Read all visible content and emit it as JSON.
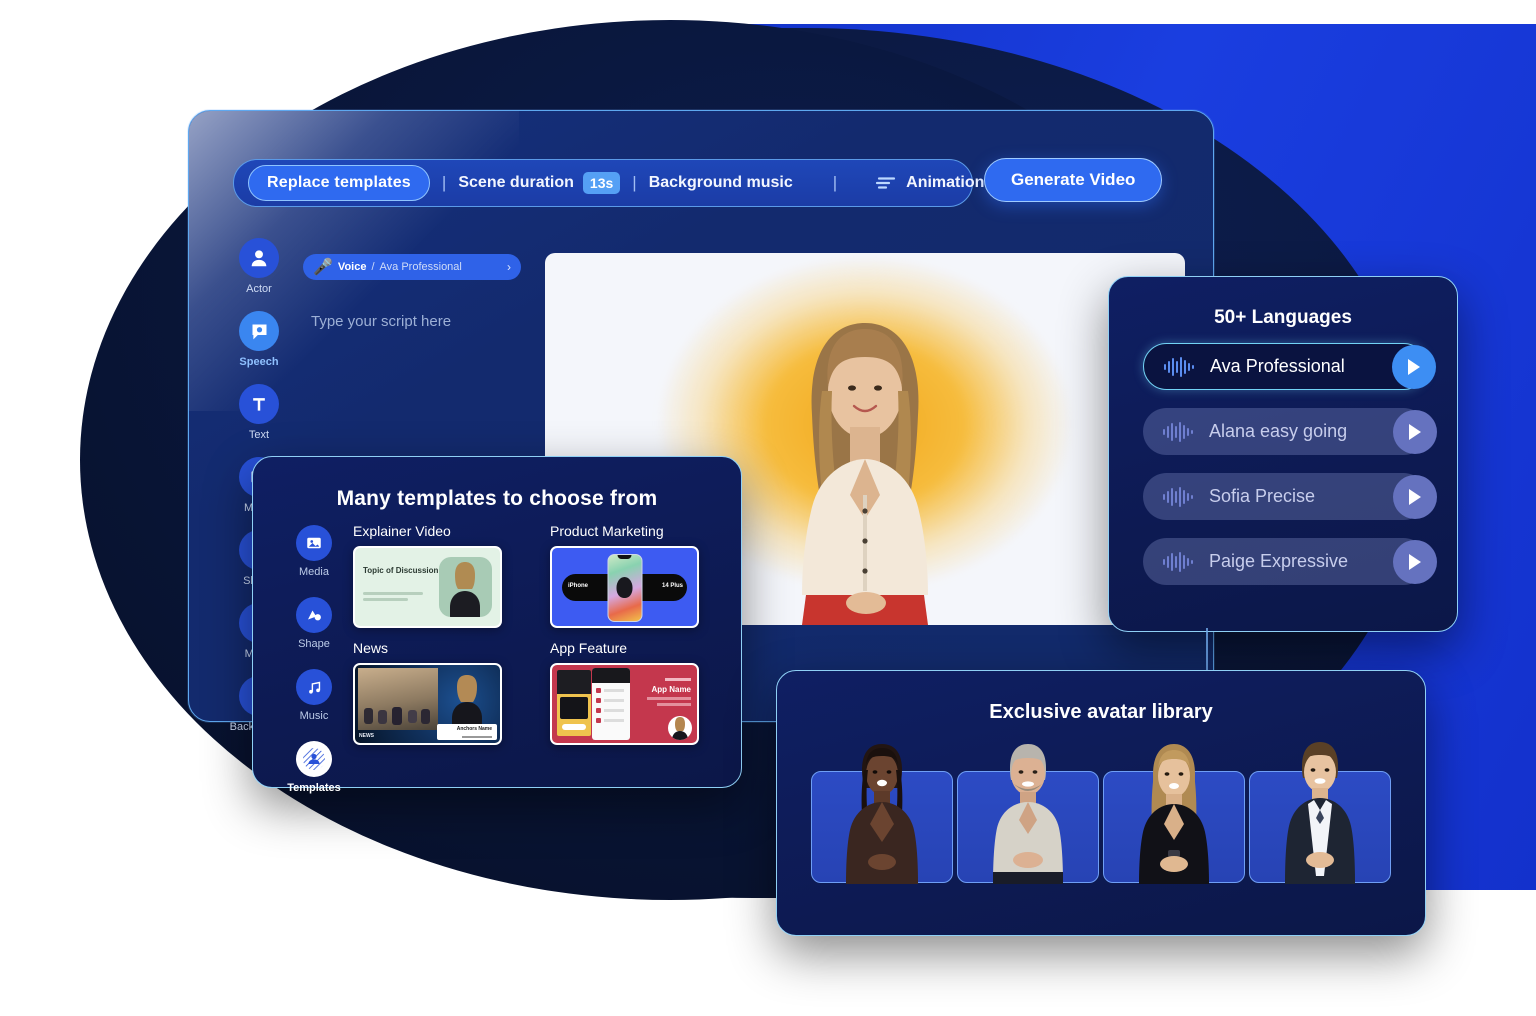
{
  "toolbar": {
    "replace_templates_label": "Replace templates",
    "separator": "|",
    "scene_duration_label": "Scene duration",
    "scene_duration_value": "13s",
    "background_music_label": "Background music",
    "animation_label": "Animation",
    "generate_video_label": "Generate Video"
  },
  "editor": {
    "voice_chip": {
      "prefix": "Voice",
      "divider": "/",
      "value": "Ava Professional",
      "chevron": "›"
    },
    "script_placeholder": "Type your script here",
    "sidebar": [
      {
        "label": "Actor",
        "icon": "person-icon",
        "active": false
      },
      {
        "label": "Speech",
        "icon": "speech-bubble-icon",
        "active": true
      },
      {
        "label": "Text",
        "icon": "text-t-icon",
        "active": false
      },
      {
        "label": "Media",
        "icon": "media-image-icon",
        "active": false
      },
      {
        "label": "Shape",
        "icon": "shape-icon",
        "active": false
      },
      {
        "label": "Music",
        "icon": "music-note-icon",
        "active": false
      },
      {
        "label": "Background",
        "icon": "background-icon",
        "active": false
      }
    ]
  },
  "templates_panel": {
    "title": "Many templates to choose from",
    "sidebar": [
      {
        "label": "Media",
        "icon": "media-image-icon"
      },
      {
        "label": "Shape",
        "icon": "shape-icon"
      },
      {
        "label": "Music",
        "icon": "music-note-icon"
      },
      {
        "label": "Templates",
        "icon": "templates-icon"
      }
    ],
    "items": [
      {
        "label": "Explainer Video",
        "thumb": "explainer-thumb",
        "thumb_text": "Topic of Discussion"
      },
      {
        "label": "Product Marketing",
        "thumb": "product-thumb",
        "thumb_text_left": "iPhone",
        "thumb_text_right": "14 Plus"
      },
      {
        "label": "News",
        "thumb": "news-thumb",
        "thumb_text": "Anchors Name"
      },
      {
        "label": "App Feature",
        "thumb": "app-thumb",
        "thumb_text": "App Name"
      }
    ]
  },
  "voices_panel": {
    "title": "50+ Languages",
    "voices": [
      {
        "name": "Ava Professional",
        "selected": true
      },
      {
        "name": "Alana easy going",
        "selected": false
      },
      {
        "name": "Sofia Precise",
        "selected": false
      },
      {
        "name": "Paige Expressive",
        "selected": false
      }
    ]
  },
  "avatars_panel": {
    "title": "Exclusive avatar library",
    "avatars": [
      {
        "name": "avatar-1"
      },
      {
        "name": "avatar-2"
      },
      {
        "name": "avatar-3"
      },
      {
        "name": "avatar-4"
      }
    ]
  },
  "colors": {
    "accent_blue": "#2f6af0",
    "cyan_border": "#72d3f5",
    "deep_navy": "#0c1748",
    "bright_blue_band": "#1a3ee0",
    "badge_blue": "#55a0f5"
  }
}
